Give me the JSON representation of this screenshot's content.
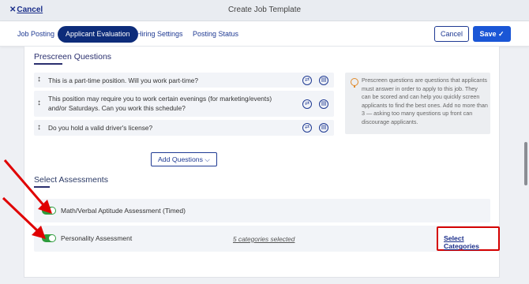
{
  "header": {
    "cancel_link": "Cancel",
    "title": "Create Job Template"
  },
  "tabs": [
    {
      "label": "Job Posting",
      "active": false
    },
    {
      "label": "Applicant Evaluation",
      "active": true
    },
    {
      "label": "Hiring Settings",
      "active": false
    },
    {
      "label": "Posting Status",
      "active": false
    }
  ],
  "actions": {
    "cancel": "Cancel",
    "save": "Save"
  },
  "prescreen": {
    "title": "Prescreen Questions",
    "questions": [
      "This is a part-time position. Will you work part-time?",
      "This position may require you to work certain evenings (for marketing/events) and/or Saturdays. Can you work this schedule?",
      "Do you hold a valid driver's license?"
    ],
    "info": "Prescreen questions are questions that applicants must answer in order to apply to this job. They can be scored and can help you quickly screen applicants to find the best ones. Add no more than 3 — asking too many questions up front can discourage applicants.",
    "add_button": "Add Questions"
  },
  "assessments": {
    "title": "Select Assessments",
    "items": [
      {
        "label": "Math/Verbal Aptitude Assessment (Timed)",
        "enabled": true
      },
      {
        "label": "Personality Assessment",
        "enabled": true,
        "categories_selected": "5 categories selected",
        "select_link": "Select Categories"
      }
    ]
  },
  "colors": {
    "primary": "#1a56d6",
    "nav_active": "#0d2c7a",
    "toggle_on": "#2e9c3c",
    "highlight": "#d40000",
    "annotation_arrow": "#e00000"
  }
}
